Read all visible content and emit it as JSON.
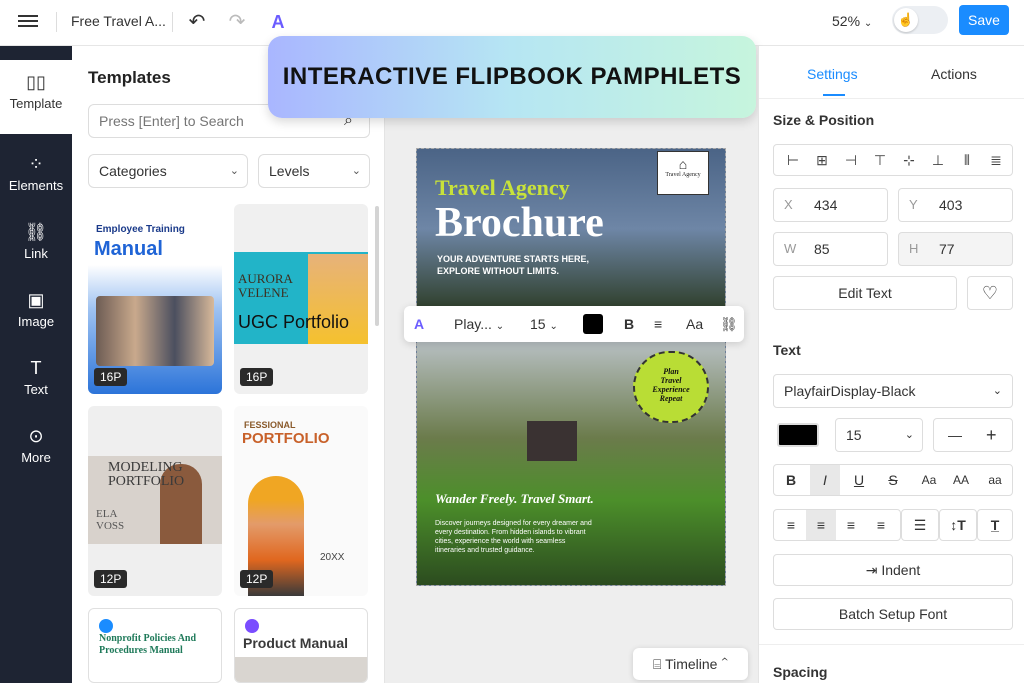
{
  "topbar": {
    "doc_title": "Free Travel A...",
    "zoom": "52%",
    "save_label": "Save"
  },
  "sidenav": [
    {
      "label": "Template",
      "icon": "template-icon"
    },
    {
      "label": "Elements",
      "icon": "elements-icon"
    },
    {
      "label": "Link",
      "icon": "link-icon"
    },
    {
      "label": "Image",
      "icon": "image-icon"
    },
    {
      "label": "Text",
      "icon": "text-icon"
    },
    {
      "label": "More",
      "icon": "more-icon"
    }
  ],
  "templates": {
    "title": "Templates",
    "search_placeholder": "Press [Enter] to Search",
    "categories_label": "Categories",
    "levels_label": "Levels",
    "cards": [
      {
        "title_small": "Employee Training",
        "title": "Manual",
        "pages": "16P"
      },
      {
        "title_small": "AURORA VELENE",
        "title": "UGC Portfolio",
        "pages": "16P"
      },
      {
        "title_small": "MODELING",
        "title": "PORTFOLIO",
        "sub": "ELA VOSS",
        "pages": "12P"
      },
      {
        "title_small": "FESSIONAL",
        "title": "PORTFOLIO",
        "sub": "20XX",
        "pages": "12P"
      },
      {
        "title": "Nonprofit Policies And Procedures Manual"
      },
      {
        "title": "Product Manual"
      }
    ]
  },
  "banner": {
    "text": "INTERACTIVE FLIPBOOK PAMPHLETS"
  },
  "page": {
    "headline_small": "Travel Agency",
    "headline": "Brochure",
    "tagline": "YOUR ADVENTURE STARTS HERE, EXPLORE WITHOUT LIMITS.",
    "logo_text": "Travel Agency",
    "badge_lines": [
      "Plan",
      "Travel",
      "Experience",
      "Repeat"
    ],
    "script_title": "Wander Freely. Travel Smart.",
    "body": "Discover journeys designed for every dreamer and every destination. From hidden islands to vibrant cities, experience the world with seamless itineraries and trusted guidance."
  },
  "float_toolbar": {
    "font": "Play...",
    "size": "15"
  },
  "timeline": {
    "label": "Timeline"
  },
  "settings": {
    "tabs": [
      "Settings",
      "Actions"
    ],
    "size_position_label": "Size & Position",
    "x_label": "X",
    "x": "434",
    "y_label": "Y",
    "y": "403",
    "w_label": "W",
    "w": "85",
    "h_label": "H",
    "h": "77",
    "edit_text_label": "Edit Text",
    "text_label": "Text",
    "font": "PlayfairDisplay-Black",
    "font_size": "15",
    "indent_label": "Indent",
    "batch_label": "Batch Setup Font",
    "spacing_label": "Spacing",
    "case_buttons": [
      "Aa",
      "AA",
      "aa"
    ]
  },
  "colors": {
    "accent": "#1a8cff",
    "nav_bg": "#1e2433",
    "text_color": "#000000"
  }
}
